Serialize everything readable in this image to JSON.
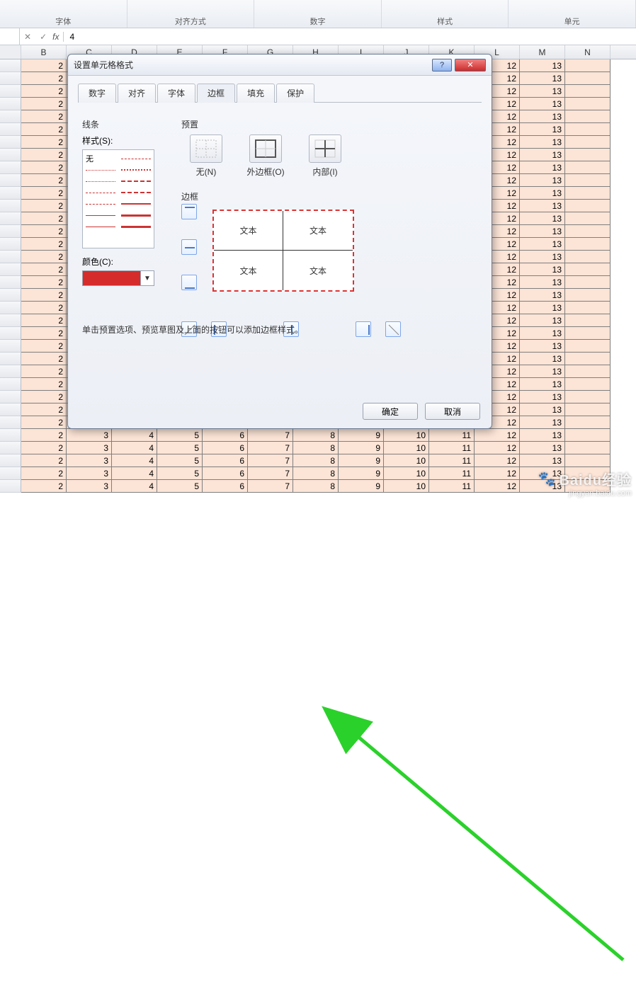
{
  "ribbon": {
    "groups": [
      "字体",
      "对齐方式",
      "数字",
      "样式",
      "单元"
    ]
  },
  "formula_bar": {
    "fx_label": "fx",
    "value": "4"
  },
  "columns_visible": [
    "",
    "B",
    "C",
    "D",
    "E",
    "F",
    "G",
    "H",
    "I",
    "J",
    "K",
    "L",
    "M",
    "N"
  ],
  "cell_values_by_col": {
    "B": "2",
    "C": "3",
    "D": "4",
    "E": "5",
    "F": "6",
    "G": "7",
    "H": "8",
    "I": "9",
    "J": "10",
    "K": "11",
    "L": "12",
    "M": "13",
    "N": ""
  },
  "dialog": {
    "title": "设置单元格格式",
    "tabs": [
      "数字",
      "对齐",
      "字体",
      "边框",
      "填充",
      "保护"
    ],
    "active_tab_index": 3,
    "line": {
      "label": "线条",
      "style_label": "样式(S):",
      "none_label": "无"
    },
    "color": {
      "label": "颜色(C):",
      "value": "#d52b2b"
    },
    "preset": {
      "label": "预置",
      "items": [
        {
          "caption": "无(N)"
        },
        {
          "caption": "外边框(O)"
        },
        {
          "caption": "内部(I)"
        }
      ]
    },
    "border": {
      "label": "边框",
      "sample_text": "文本"
    },
    "hint": "单击预置选项、预览草图及上面的按钮可以添加边框样式。",
    "ok": "确定",
    "cancel": "取消"
  },
  "watermark": {
    "brand": "Baidu经验",
    "url": "jingyan.baidu.com"
  }
}
